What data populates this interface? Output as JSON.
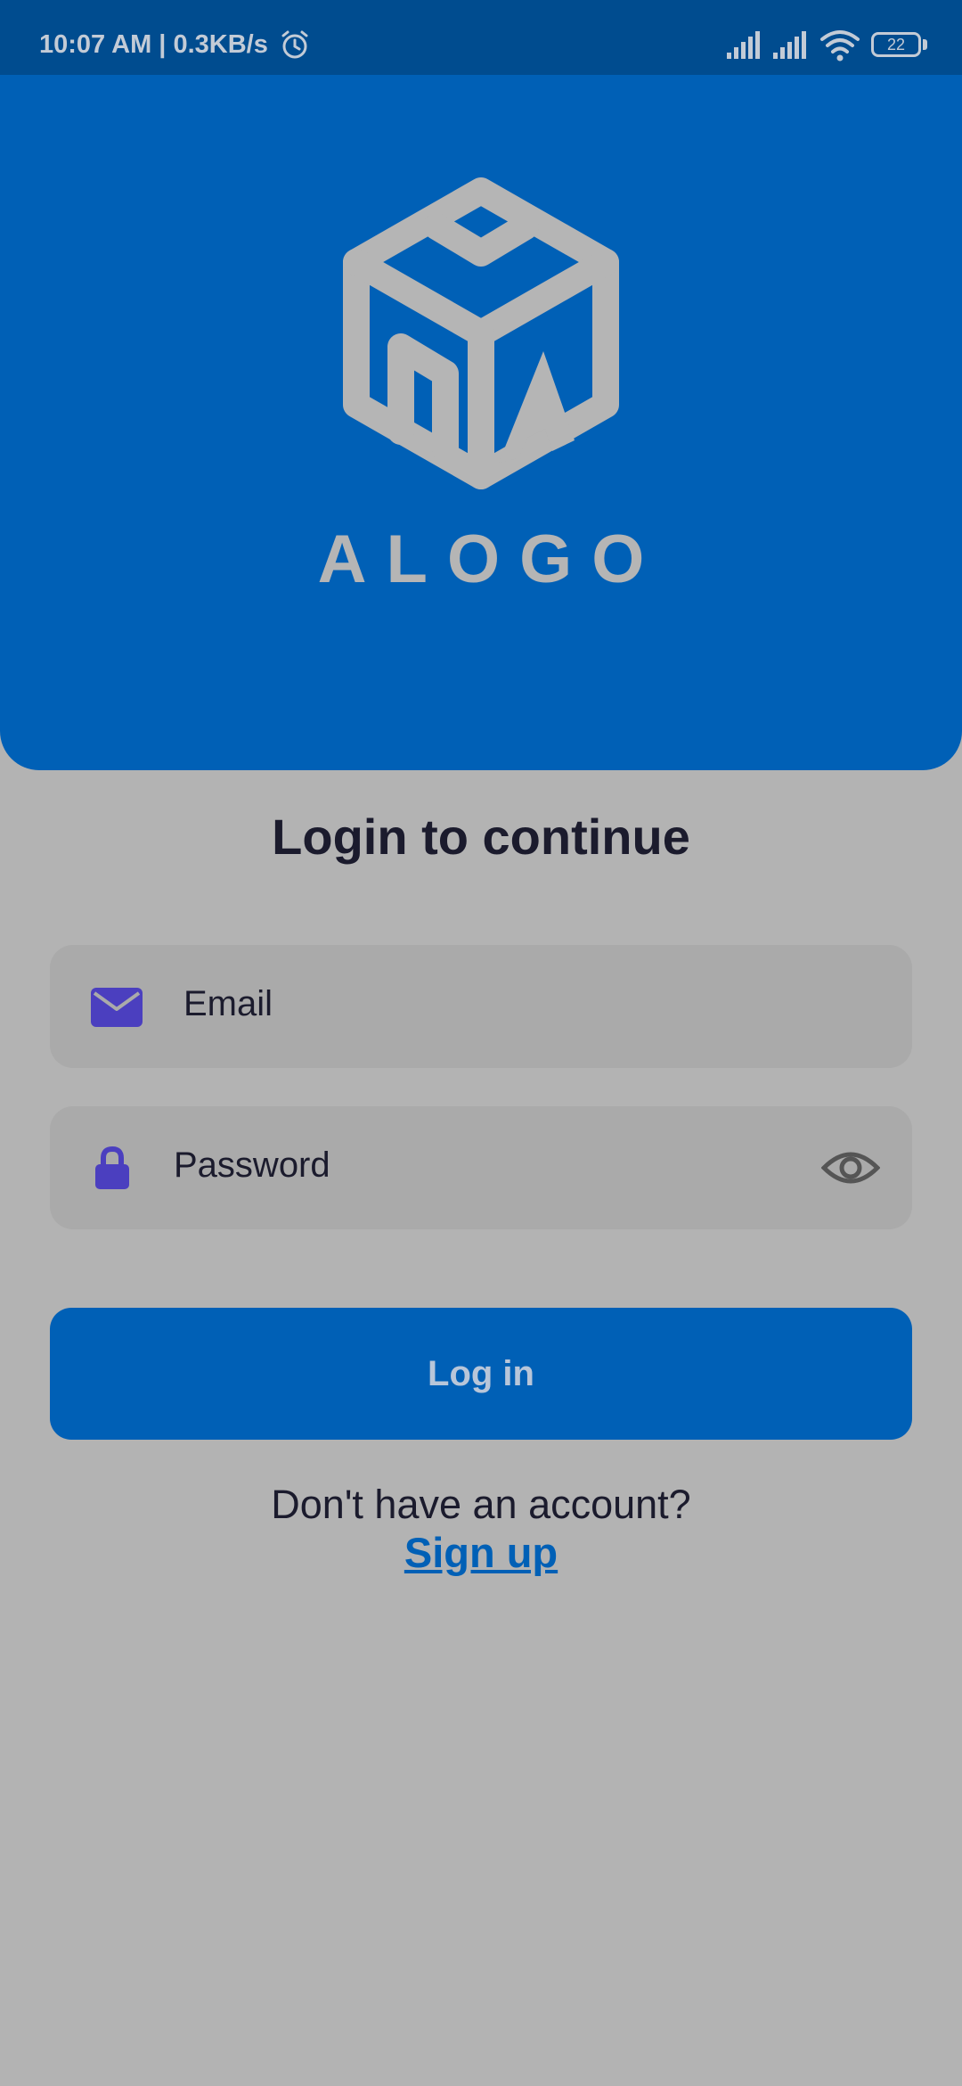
{
  "status_bar": {
    "time_speed": "10:07 AM | 0.3KB/s",
    "battery": "22",
    "icons": [
      "alarm-icon",
      "signal-icon",
      "signal-icon",
      "wifi-icon",
      "battery-icon"
    ]
  },
  "hero": {
    "logo_text": "ALOGO",
    "logo_icon": "cube-logo-icon"
  },
  "login": {
    "title": "Login to continue",
    "email_placeholder": "Email",
    "email_icon": "mail-icon",
    "password_placeholder": "Password",
    "password_icon": "lock-icon",
    "visibility_icon": "eye-icon",
    "login_button": "Log in",
    "no_account_text": "Don't have an account?",
    "signup_link": "Sign up"
  },
  "colors": {
    "hero_blue": "#0060b6",
    "status_bar": "#004c8f",
    "background": "#b3b3b3",
    "field_bg": "#aaaaaa",
    "icon_purple": "#4b3fbf",
    "text_dark": "#1b1b2d"
  }
}
